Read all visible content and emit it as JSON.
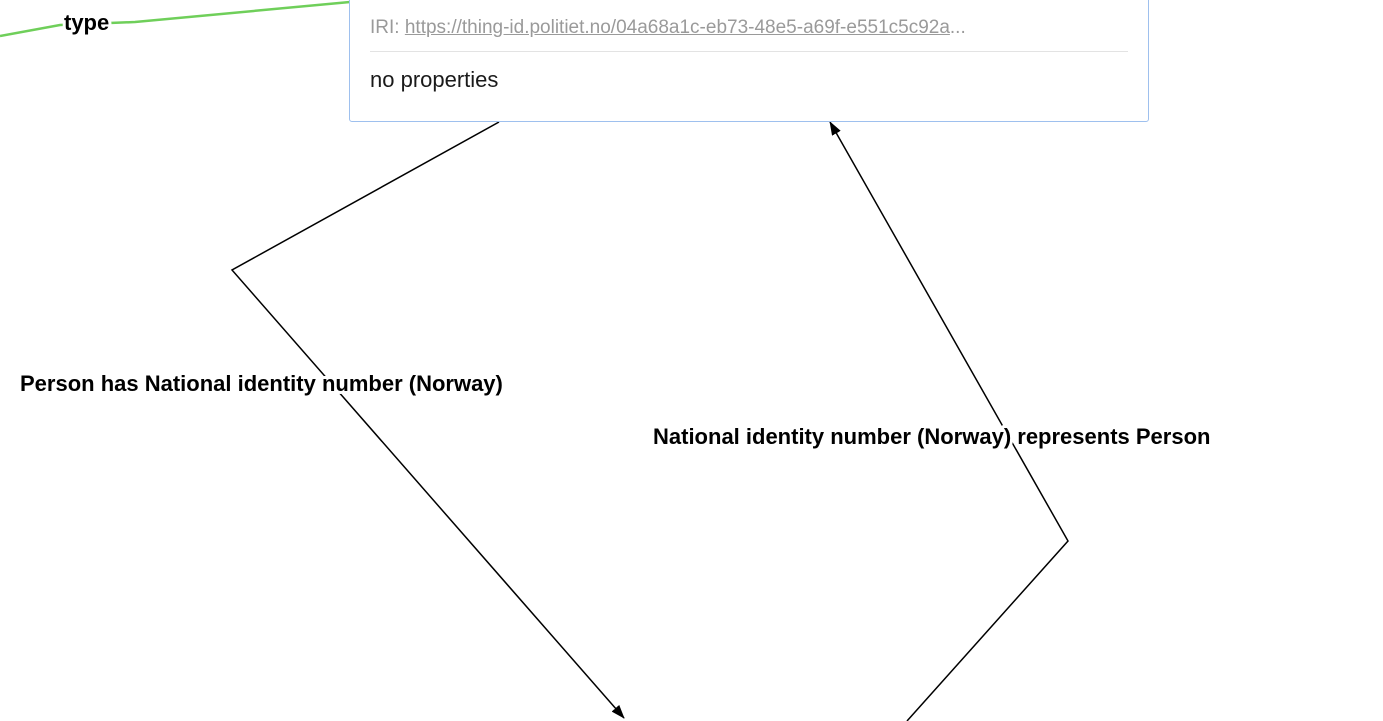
{
  "element_card": {
    "iri_label": "IRI:",
    "iri": "https://thing-id.politiet.no/04a68a1c-eb73-48e5-a69f-e551c5c92a",
    "iri_ellipsis": "...",
    "properties_text": "no properties"
  },
  "links": {
    "type_label": "type",
    "has_label": "Person has National identity number (Norway)",
    "represents_label": "National identity number (Norway) represents Person"
  },
  "colors": {
    "type_link": "#6fcf5a",
    "relation_link": "#000000",
    "card_border": "#9ec0ee"
  }
}
